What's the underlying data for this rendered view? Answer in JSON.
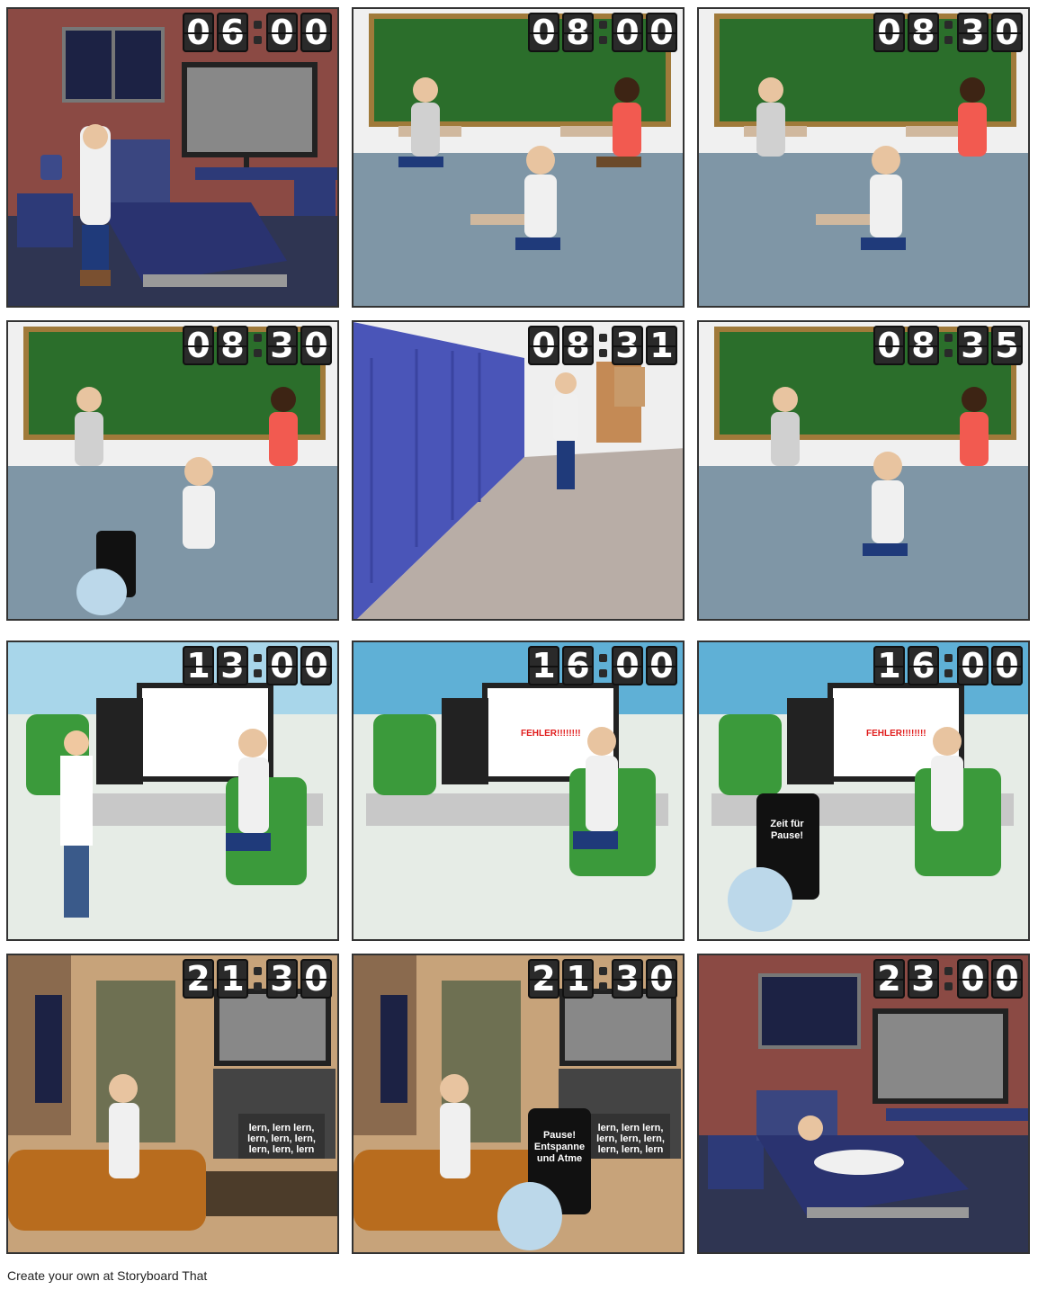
{
  "panels": [
    {
      "time": [
        "0",
        "6",
        "0",
        "0"
      ],
      "scene": "bedroom-morning"
    },
    {
      "time": [
        "0",
        "8",
        "0",
        "0"
      ],
      "scene": "classroom"
    },
    {
      "time": [
        "0",
        "8",
        "3",
        "0"
      ],
      "scene": "classroom"
    },
    {
      "time": [
        "0",
        "8",
        "3",
        "0"
      ],
      "scene": "classroom-phone"
    },
    {
      "time": [
        "0",
        "8",
        "3",
        "1"
      ],
      "scene": "hallway"
    },
    {
      "time": [
        "0",
        "8",
        "3",
        "5"
      ],
      "scene": "classroom"
    },
    {
      "time": [
        "1",
        "3",
        "0",
        "0"
      ],
      "scene": "office-boss"
    },
    {
      "time": [
        "1",
        "6",
        "0",
        "0"
      ],
      "scene": "office-error"
    },
    {
      "time": [
        "1",
        "6",
        "0",
        "0"
      ],
      "scene": "office-phone"
    },
    {
      "time": [
        "2",
        "1",
        "3",
        "0"
      ],
      "scene": "living-room"
    },
    {
      "time": [
        "2",
        "1",
        "3",
        "0"
      ],
      "scene": "living-room-phone"
    },
    {
      "time": [
        "2",
        "3",
        "0",
        "0"
      ],
      "scene": "bedroom-night"
    }
  ],
  "texts": {
    "error_msg": "FEHLER!!!!!!!!",
    "phone_break": "Zeit für Pause!",
    "tv_learn": "lern, lern lern, lern, lern, lern, lern, lern, lern",
    "phone_relax": "Pause! Entspanne und Atme"
  },
  "footer": "Create your own at Storyboard That"
}
